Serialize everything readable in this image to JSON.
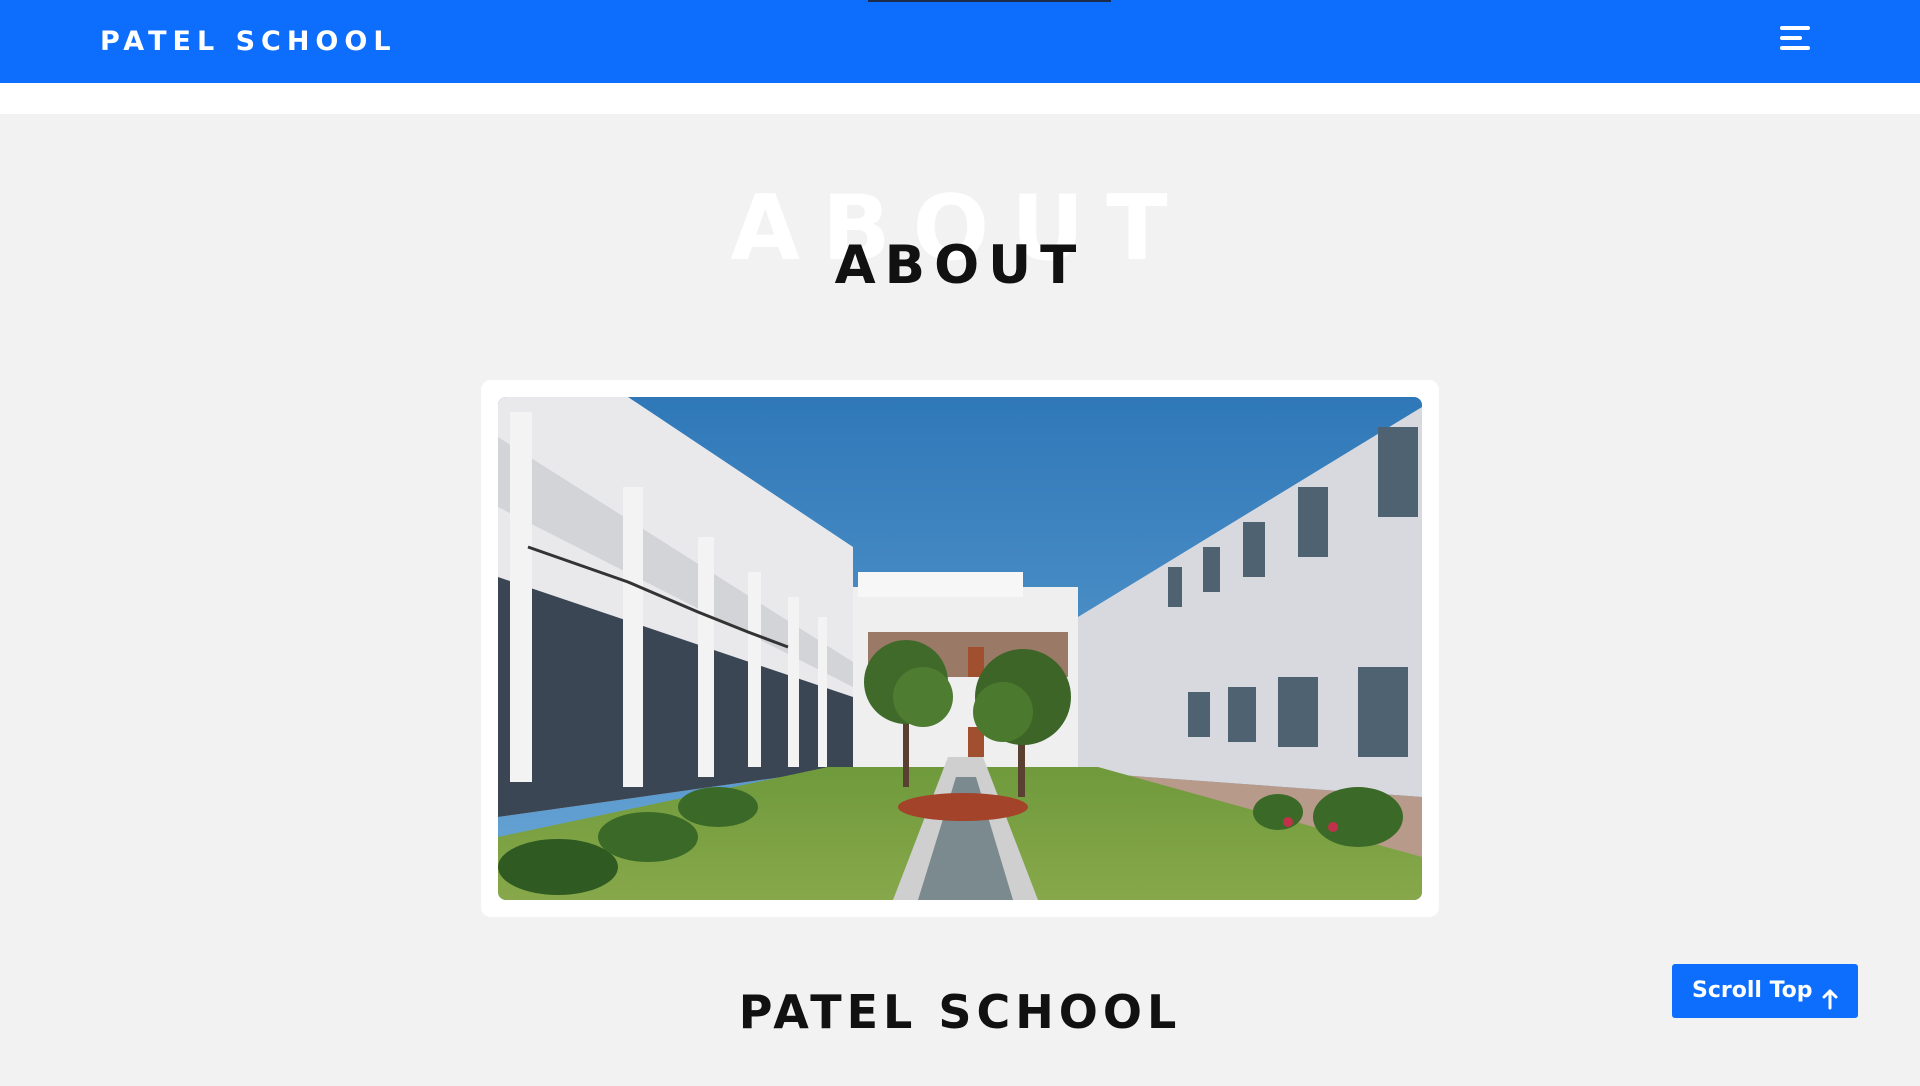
{
  "header": {
    "brand": "PATEL SCHOOL",
    "menu_icon": "menu-icon",
    "background_color": "#0d6efd"
  },
  "about": {
    "background_heading": "ABOUT",
    "heading": "ABOUT",
    "image_alt": "school-courtyard-photo",
    "school_title": "PATEL SCHOOL"
  },
  "scroll_top": {
    "label": "Scroll Top",
    "icon": "arrow-up-icon"
  }
}
